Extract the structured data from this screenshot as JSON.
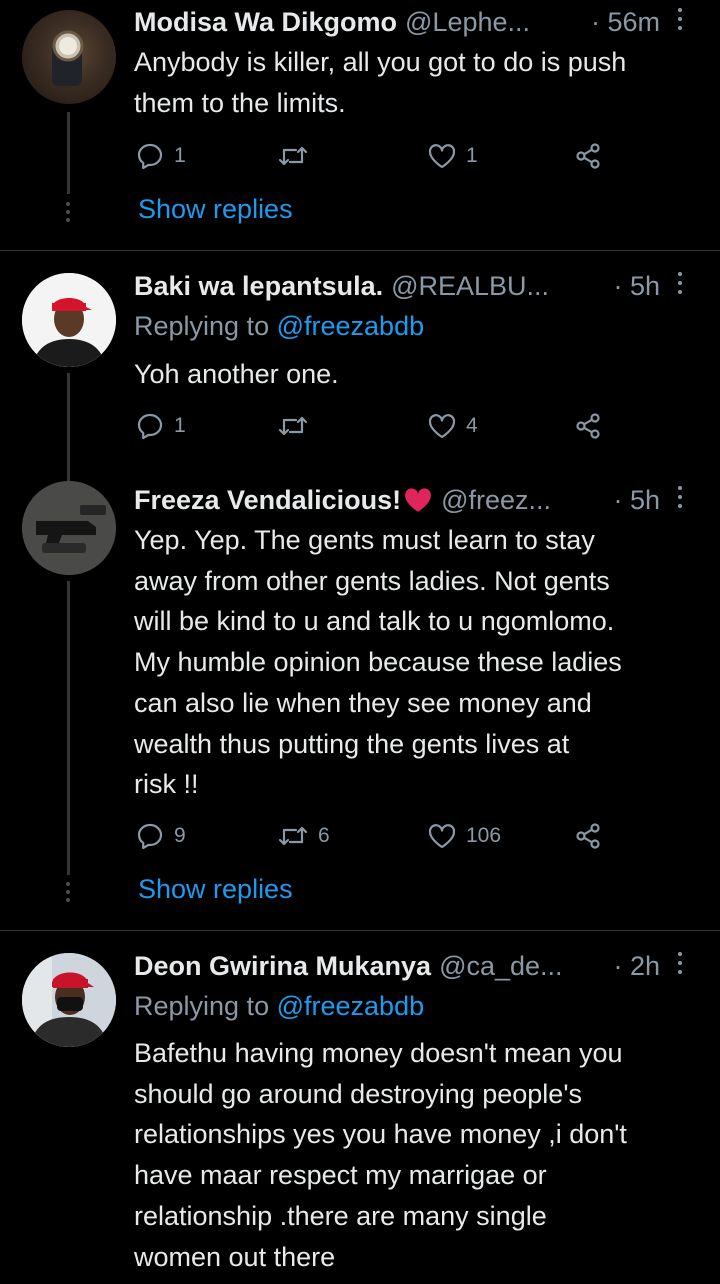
{
  "tweets": [
    {
      "name": "Modisa Wa Dikgomo",
      "handle": "@Lephe...",
      "time": "· 56m",
      "replying_label": "",
      "replying_to": "",
      "lines": [
        "Anybody is killer, all you got to do is push",
        "them to the limits."
      ],
      "replies": "1",
      "retweets": "",
      "likes": "1",
      "show_replies": "Show replies"
    },
    {
      "name": "Baki wa lepantsula.",
      "handle": "@REALBU...",
      "time": "· 5h",
      "replying_label": "Replying to",
      "replying_to": "@freezabdb",
      "lines": [
        "Yoh another one."
      ],
      "replies": "1",
      "retweets": "",
      "likes": "4",
      "show_replies": ""
    },
    {
      "name": "Freeza Vendalicious!",
      "handle": "@freez...",
      "time": "· 5h",
      "replying_label": "",
      "replying_to": "",
      "lines": [
        "Yep. Yep. The gents must learn to stay",
        "away from other gents ladies. Not gents",
        "will be kind to u and talk to u ngomlomo.",
        "My humble opinion because these ladies",
        "can also lie when they see money and",
        "wealth thus putting the gents lives at",
        "risk !!"
      ],
      "replies": "9",
      "retweets": "6",
      "likes": "106",
      "show_replies": "Show replies"
    },
    {
      "name": "Deon Gwirina Mukanya",
      "handle": "@ca_de...",
      "time": "· 2h",
      "replying_label": "Replying to",
      "replying_to": "@freezabdb",
      "lines": [
        "Bafethu having money doesn't mean you",
        "should go around  destroying people's",
        "relationships yes you have money ,i don't",
        "have maar respect my marrigae or",
        "relationship .there are many single",
        "women out there"
      ],
      "replies": "",
      "retweets": "",
      "likes": "",
      "show_replies": ""
    }
  ],
  "colors": {
    "accent": "#1d9bf0",
    "muted": "#8b98a5",
    "heart": "#e0245e"
  }
}
